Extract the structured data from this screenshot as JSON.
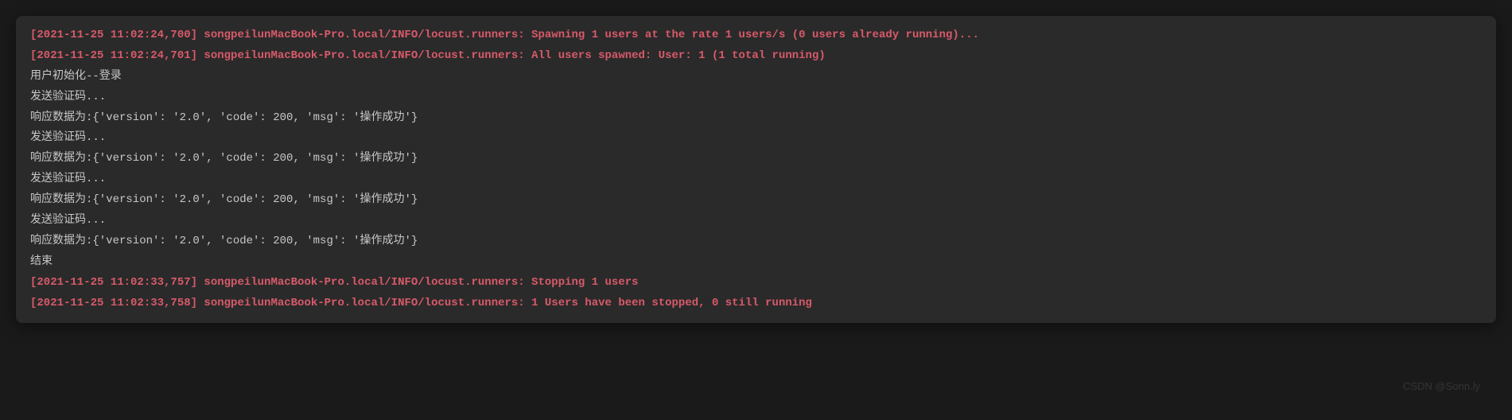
{
  "terminal": {
    "lines": [
      {
        "type": "log",
        "text": "[2021-11-25 11:02:24,700] songpeilunMacBook-Pro.local/INFO/locust.runners: Spawning 1 users at the rate 1 users/s (0 users already running)..."
      },
      {
        "type": "log",
        "text": "[2021-11-25 11:02:24,701] songpeilunMacBook-Pro.local/INFO/locust.runners: All users spawned: User: 1 (1 total running)"
      },
      {
        "type": "out",
        "text": "用户初始化--登录"
      },
      {
        "type": "out",
        "text": "发送验证码..."
      },
      {
        "type": "out",
        "text": "响应数据为:{'version': '2.0', 'code': 200, 'msg': '操作成功'}"
      },
      {
        "type": "out",
        "text": "发送验证码..."
      },
      {
        "type": "out",
        "text": "响应数据为:{'version': '2.0', 'code': 200, 'msg': '操作成功'}"
      },
      {
        "type": "out",
        "text": "发送验证码..."
      },
      {
        "type": "out",
        "text": "响应数据为:{'version': '2.0', 'code': 200, 'msg': '操作成功'}"
      },
      {
        "type": "out",
        "text": "发送验证码..."
      },
      {
        "type": "out",
        "text": "响应数据为:{'version': '2.0', 'code': 200, 'msg': '操作成功'}"
      },
      {
        "type": "out",
        "text": "结束"
      },
      {
        "type": "log",
        "text": "[2021-11-25 11:02:33,757] songpeilunMacBook-Pro.local/INFO/locust.runners: Stopping 1 users"
      },
      {
        "type": "log",
        "text": "[2021-11-25 11:02:33,758] songpeilunMacBook-Pro.local/INFO/locust.runners: 1 Users have been stopped, 0 still running"
      }
    ]
  },
  "watermark": "CSDN @Sonn.ly"
}
